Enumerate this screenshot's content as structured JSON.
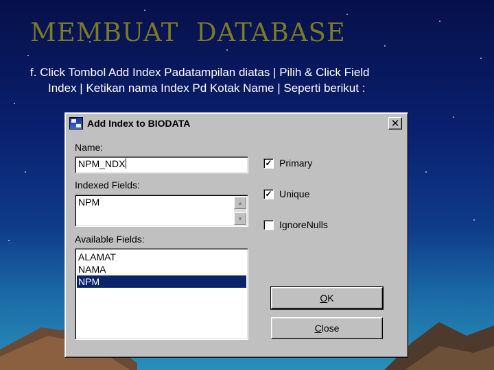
{
  "slide": {
    "title": "MEMBUAT  DATABASE",
    "instruction_line1": "f. Click Tombol Add Index Padatampilan diatas | Pilih & Click Field",
    "instruction_line2": "Index | Ketikan nama Index Pd Kotak Name  | Seperti berikut :"
  },
  "dialog": {
    "title": "Add Index to BIODATA",
    "close_glyph": "✕",
    "name_label": "Name:",
    "name_value": "NPM_NDX",
    "indexed_label": "Indexed Fields:",
    "indexed_value": "NPM",
    "available_label": "Available Fields:",
    "available_fields": [
      "ALAMAT",
      "NAMA",
      "NPM"
    ],
    "selected_field": "NPM",
    "options": [
      {
        "label": "Primary",
        "checked": true
      },
      {
        "label": "Unique",
        "checked": true
      },
      {
        "label": "IgnoreNulls",
        "checked": false
      }
    ],
    "ok_first": "O",
    "ok_rest": "K",
    "close_first": "C",
    "close_rest": "lose",
    "icons": [
      "app-icon",
      "close-icon",
      "scroll-up-icon",
      "scroll-down-icon",
      "check-icon"
    ]
  },
  "colors": {
    "title": "#7b7b23",
    "selection": "#0a246a",
    "dialog_face": "#c0c0c0"
  }
}
